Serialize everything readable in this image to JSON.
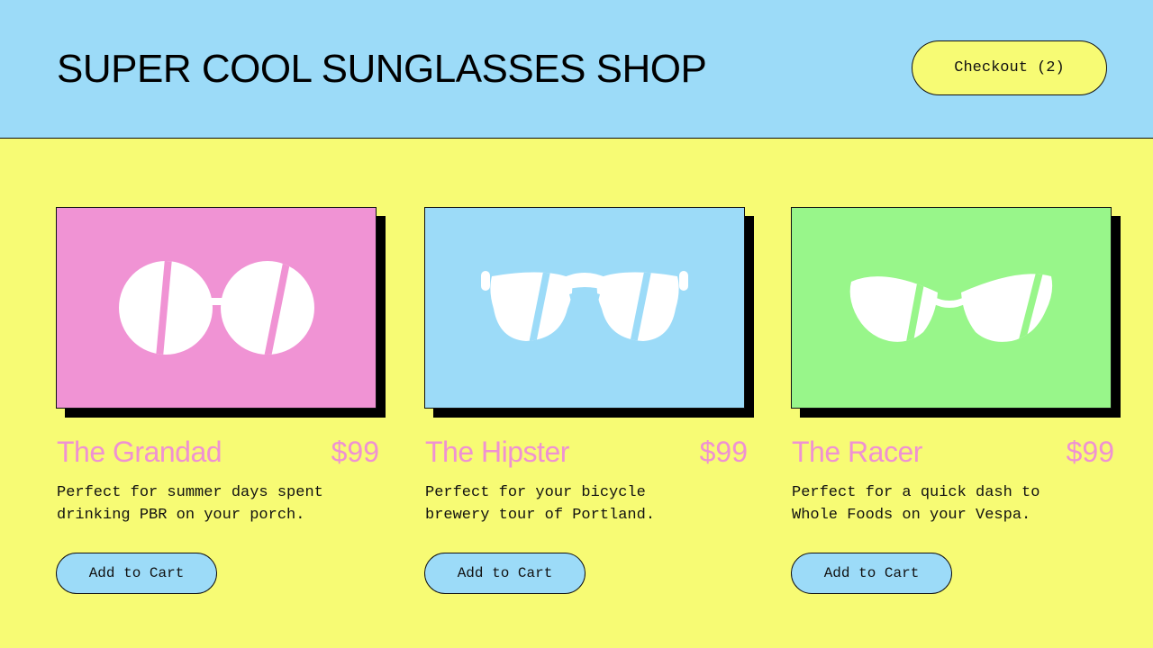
{
  "header": {
    "title": "SUPER COOL SUNGLASSES SHOP",
    "checkout_label": "Checkout (2)"
  },
  "colors": {
    "header_bg": "#9cdbf8",
    "page_bg": "#f7fb74",
    "accent_text": "#ef92d2",
    "button_bg": "#9cdbf8"
  },
  "products": [
    {
      "name": "The Grandad",
      "price": "$99",
      "description_lines": [
        "Perfect for summer days spent",
        "drinking PBR on your porch."
      ],
      "button_label": "Add to Cart",
      "image_bg": "#f093d4",
      "icon": "round-sunglasses-icon"
    },
    {
      "name": "The Hipster",
      "price": "$99",
      "description_lines": [
        "Perfect for your bicycle",
        "brewery tour of Portland."
      ],
      "button_label": "Add to Cart",
      "image_bg": "#9cdbf8",
      "icon": "aviator-sunglasses-icon"
    },
    {
      "name": "The Racer",
      "price": "$99",
      "description_lines": [
        "Perfect for a quick dash to",
        "Whole Foods on your Vespa."
      ],
      "button_label": "Add to Cart",
      "image_bg": "#98f68a",
      "icon": "cat-eye-sunglasses-icon"
    }
  ]
}
